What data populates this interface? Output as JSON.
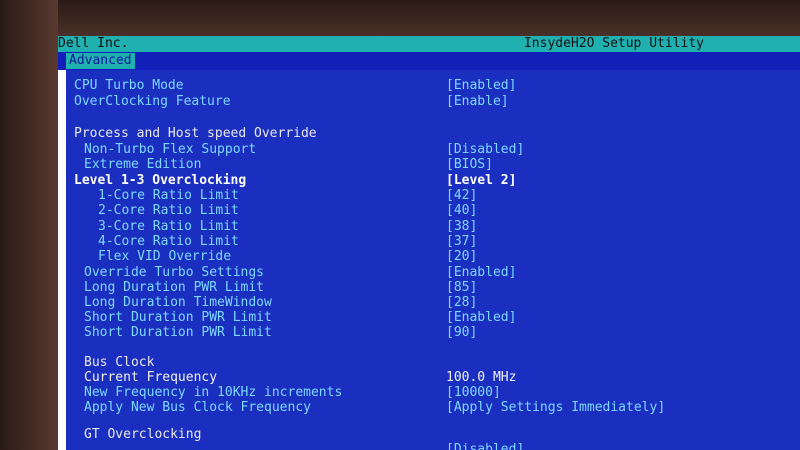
{
  "header": {
    "vendor": "Dell Inc.",
    "utility": "InsydeH2O Setup Utility",
    "tab": "Advanced"
  },
  "colors": {
    "title_bar": "#20b0b0",
    "menu_bar": "#1020b8",
    "panel": "#1a2fc0",
    "selected_text": "#ffffff"
  },
  "settings": [
    {
      "label": "CPU Turbo Mode",
      "value": "[Enabled]",
      "indent": 0,
      "style": "cyan"
    },
    {
      "label": "OverClocking Feature",
      "value": "[Enable]",
      "indent": 0,
      "style": "cyan"
    },
    {
      "label": "Process and Host speed Override",
      "value": "",
      "indent": 0,
      "style": "head"
    },
    {
      "label": "Non-Turbo Flex Support",
      "value": "[Disabled]",
      "indent": 1,
      "style": "cyan"
    },
    {
      "label": "Extreme Edition",
      "value": "[BIOS]",
      "indent": 1,
      "style": "cyan"
    },
    {
      "label": "Level 1-3 Overclocking",
      "value": "[Level 2]",
      "indent": 0,
      "style": "sel"
    },
    {
      "label": "1-Core Ratio Limit",
      "value": "[42]",
      "indent": 2,
      "style": "cyan"
    },
    {
      "label": "2-Core Ratio Limit",
      "value": "[40]",
      "indent": 2,
      "style": "cyan"
    },
    {
      "label": "3-Core Ratio Limit",
      "value": "[38]",
      "indent": 2,
      "style": "cyan"
    },
    {
      "label": "4-Core Ratio Limit",
      "value": "[37]",
      "indent": 2,
      "style": "cyan"
    },
    {
      "label": "Flex VID Override",
      "value": "[20]",
      "indent": 2,
      "style": "cyan"
    },
    {
      "label": "Override Turbo Settings",
      "value": "[Enabled]",
      "indent": 1,
      "style": "cyan"
    },
    {
      "label": "Long Duration PWR Limit",
      "value": "[85]",
      "indent": 1,
      "style": "cyan"
    },
    {
      "label": "Long Duration TimeWindow",
      "value": "[28]",
      "indent": 1,
      "style": "cyan"
    },
    {
      "label": "Short Duration PWR Limit",
      "value": "[Enabled]",
      "indent": 1,
      "style": "cyan"
    },
    {
      "label": "Short Duration PWR Limit",
      "value": "[90]",
      "indent": 1,
      "style": "cyan"
    },
    {
      "label": "Bus Clock",
      "value": "",
      "indent": 1,
      "style": "head"
    },
    {
      "label": "Current Frequency",
      "value": "100.0 MHz",
      "indent": 1,
      "style": "white"
    },
    {
      "label": "New Frequency in 10KHz increments",
      "value": "[10000]",
      "indent": 1,
      "style": "cyan"
    },
    {
      "label": "Apply New Bus Clock Frequency",
      "value": "[Apply Settings Immediately]",
      "indent": 1,
      "style": "cyan"
    },
    {
      "label": "GT Overclocking",
      "value": "",
      "indent": 1,
      "style": "head"
    },
    {
      "label": "",
      "value": "[Disabled]",
      "indent": 1,
      "style": "cyan"
    }
  ]
}
